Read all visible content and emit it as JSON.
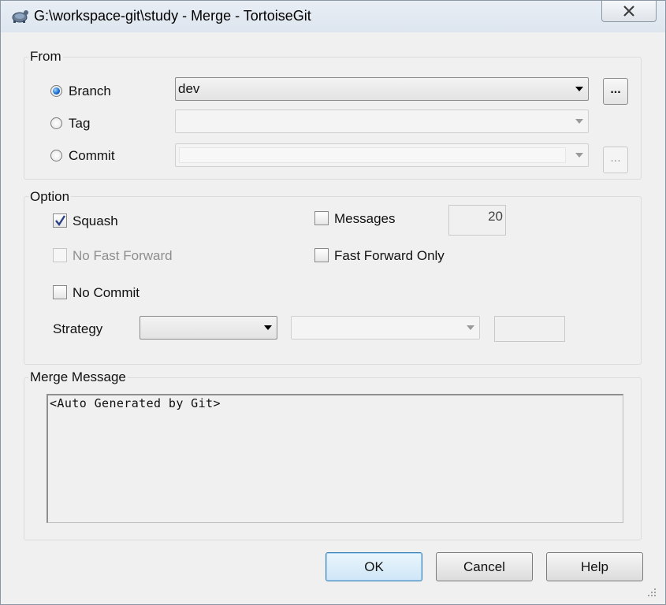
{
  "window": {
    "title": "G:\\workspace-git\\study - Merge - TortoiseGit"
  },
  "from_group": {
    "label": "From",
    "options": [
      {
        "label": "Branch",
        "selected": true
      },
      {
        "label": "Tag",
        "selected": false
      },
      {
        "label": "Commit",
        "selected": false
      }
    ],
    "branch_value": "dev",
    "browse_label": "..."
  },
  "option_group": {
    "label": "Option",
    "squash": {
      "label": "Squash",
      "checked": true
    },
    "no_fast_forward": {
      "label": "No Fast Forward",
      "checked": false,
      "enabled": false
    },
    "no_commit": {
      "label": "No Commit",
      "checked": false
    },
    "messages": {
      "label": "Messages",
      "checked": false,
      "count": "20"
    },
    "fast_forward_only": {
      "label": "Fast Forward Only",
      "checked": false
    },
    "strategy_label": "Strategy"
  },
  "merge_message": {
    "label": "Merge Message",
    "text": "<Auto Generated by Git>"
  },
  "buttons": {
    "ok": "OK",
    "cancel": "Cancel",
    "help": "Help"
  },
  "colors": {
    "window_bg": "#f0f0f0",
    "default_button_border": "#3c7fb1",
    "radio_selected": "#1a6fd0"
  }
}
